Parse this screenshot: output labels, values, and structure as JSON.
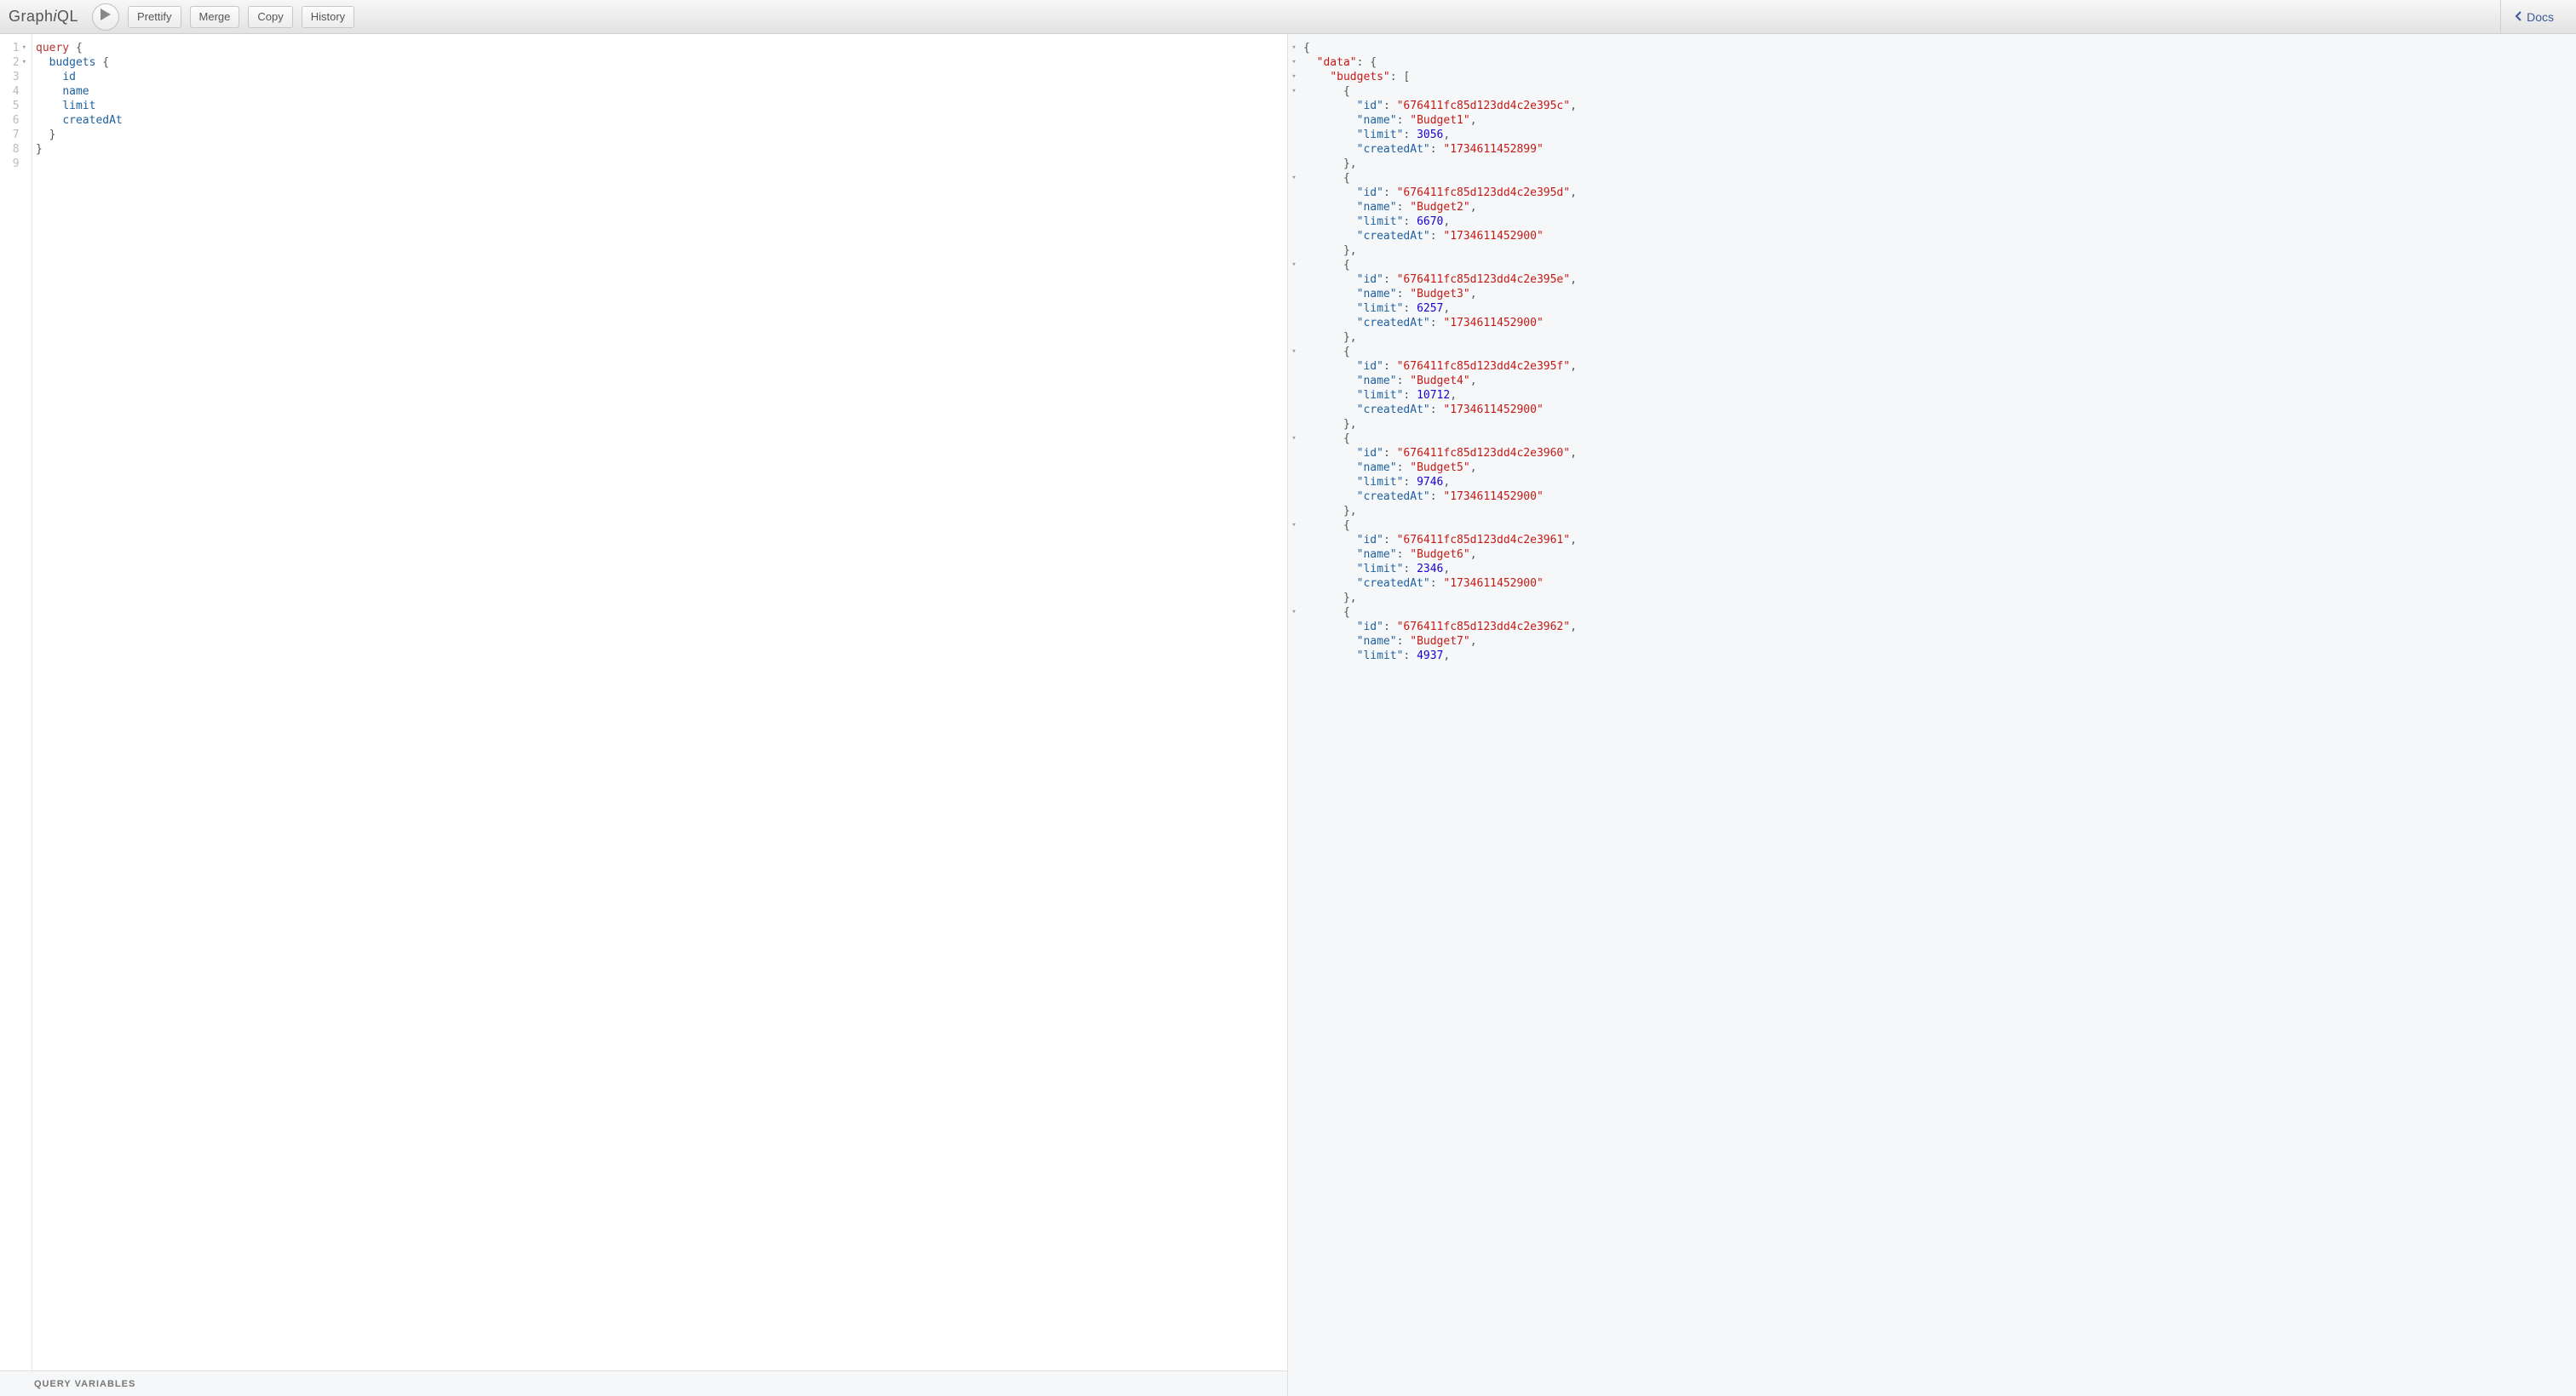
{
  "brand_plain1": "Graph",
  "brand_i": "i",
  "brand_plain2": "QL",
  "toolbar": {
    "prettify": "Prettify",
    "merge": "Merge",
    "copy": "Copy",
    "history": "History",
    "docs": "Docs"
  },
  "vars_label": "QUERY VARIABLES",
  "query_lines": [
    {
      "n": 1,
      "fold": true,
      "html": "<span class='kw'>query</span> {"
    },
    {
      "n": 2,
      "fold": true,
      "html": "  <span class='def'>budgets</span> {"
    },
    {
      "n": 3,
      "html": "    <span class='def'>id</span>"
    },
    {
      "n": 4,
      "html": "    <span class='def'>name</span>"
    },
    {
      "n": 5,
      "html": "    <span class='def'>limit</span>"
    },
    {
      "n": 6,
      "html": "    <span class='def'>createdAt</span>"
    },
    {
      "n": 7,
      "html": "  }"
    },
    {
      "n": 8,
      "html": "}"
    },
    {
      "n": 9,
      "html": ""
    }
  ],
  "result": {
    "data_key": "data",
    "budgets_key": "budgets",
    "field_keys": {
      "id": "id",
      "name": "name",
      "limit": "limit",
      "createdAt": "createdAt"
    },
    "budgets": [
      {
        "id": "676411fc85d123dd4c2e395c",
        "name": "Budget1",
        "limit": 3056,
        "createdAt": "1734611452899"
      },
      {
        "id": "676411fc85d123dd4c2e395d",
        "name": "Budget2",
        "limit": 6670,
        "createdAt": "1734611452900"
      },
      {
        "id": "676411fc85d123dd4c2e395e",
        "name": "Budget3",
        "limit": 6257,
        "createdAt": "1734611452900"
      },
      {
        "id": "676411fc85d123dd4c2e395f",
        "name": "Budget4",
        "limit": 10712,
        "createdAt": "1734611452900"
      },
      {
        "id": "676411fc85d123dd4c2e3960",
        "name": "Budget5",
        "limit": 9746,
        "createdAt": "1734611452900"
      },
      {
        "id": "676411fc85d123dd4c2e3961",
        "name": "Budget6",
        "limit": 2346,
        "createdAt": "1734611452900"
      },
      {
        "id": "676411fc85d123dd4c2e3962",
        "name": "Budget7",
        "limit": 4937,
        "createdAt": null
      }
    ]
  },
  "result_fold_rows": [
    1,
    2,
    3,
    4,
    10,
    16,
    22,
    28,
    34,
    40
  ]
}
